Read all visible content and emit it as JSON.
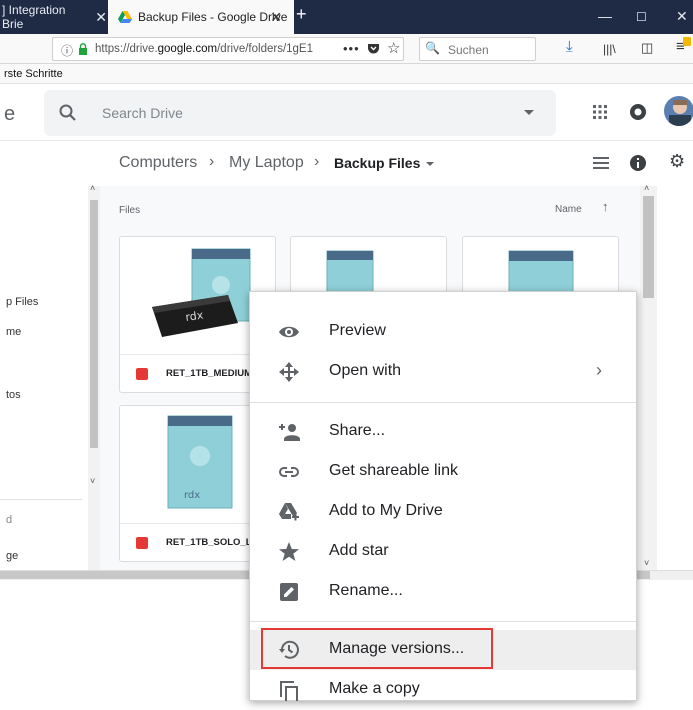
{
  "browser": {
    "tabs": [
      {
        "label": "] Integration Brie"
      },
      {
        "label": "Backup Files - Google Drive"
      }
    ],
    "url": {
      "prefix": "https://drive.",
      "domain": "google.com",
      "suffix": "/drive/folders/1gE1"
    },
    "search_placeholder": "Suchen",
    "bookmark": "rste Schritte"
  },
  "drive": {
    "logo_fragment": "e",
    "search_placeholder": "Search Drive",
    "breadcrumb": {
      "computers": "Computers",
      "laptop": "My Laptop",
      "current": "Backup Files"
    },
    "sidebar": [
      {
        "label": "p Files"
      },
      {
        "label": "me"
      },
      {
        "label": "tos"
      },
      {
        "label": "d"
      },
      {
        "label": "ge"
      }
    ],
    "files_label": "Files",
    "sort_label": "Name",
    "files": [
      {
        "name": "RET_1TB_MEDIUM"
      },
      {
        "name": "RET_1TB_SOLO_L"
      }
    ]
  },
  "menu": {
    "items": [
      {
        "label": "Preview",
        "icon": "eye-icon"
      },
      {
        "label": "Open with",
        "icon": "move-arrows-icon"
      },
      {
        "label": "Share...",
        "icon": "add-person-icon"
      },
      {
        "label": "Get shareable link",
        "icon": "link-icon"
      },
      {
        "label": "Add to My Drive",
        "icon": "drive-add-icon"
      },
      {
        "label": "Add star",
        "icon": "star-icon"
      },
      {
        "label": "Rename...",
        "icon": "pencil-icon"
      },
      {
        "label": "Manage versions...",
        "icon": "history-icon"
      },
      {
        "label": "Make a copy",
        "icon": "copy-icon"
      }
    ]
  },
  "colors": {
    "highlight": "#e53935",
    "tabstrip": "#1f2a44",
    "file_icon": "#e53935"
  }
}
